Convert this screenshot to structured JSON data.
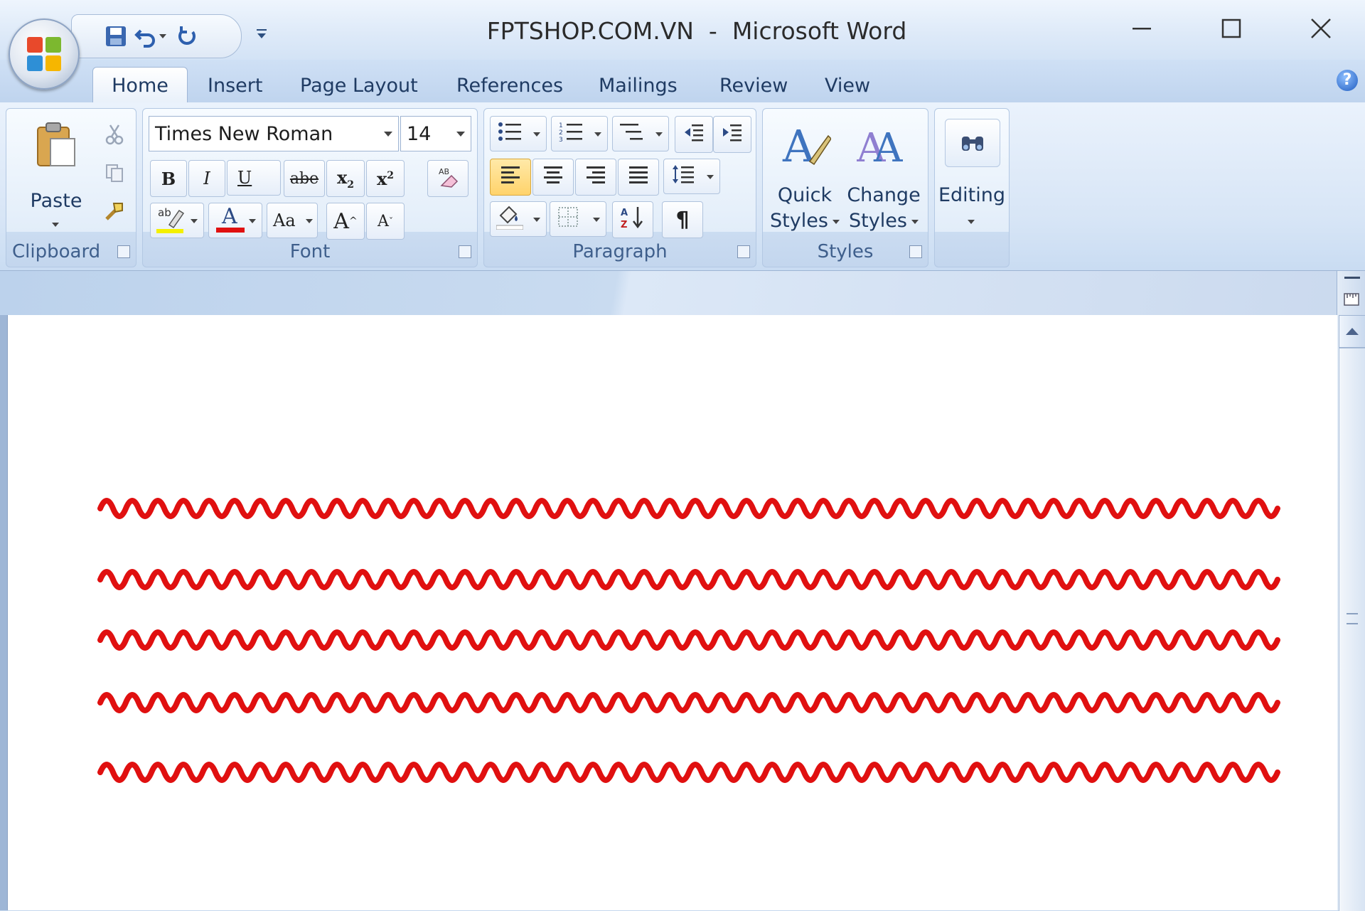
{
  "window": {
    "title": "FPTSHOP.COM.VN  -  Microsoft Word"
  },
  "quick_access": {
    "icons": [
      "save-icon",
      "undo-icon",
      "redo-icon",
      "customize-icon"
    ]
  },
  "tabs": [
    {
      "label": "Home",
      "active": true
    },
    {
      "label": "Insert"
    },
    {
      "label": "Page Layout"
    },
    {
      "label": "References"
    },
    {
      "label": "Mailings"
    },
    {
      "label": "Review"
    },
    {
      "label": "View"
    }
  ],
  "ribbon": {
    "clipboard": {
      "group_label": "Clipboard",
      "paste_label": "Paste"
    },
    "font": {
      "group_label": "Font",
      "font_name": "Times New Roman",
      "font_size": "14",
      "bold": "B",
      "italic": "I",
      "underline": "U",
      "strikethrough": "abe",
      "change_case": "Aa",
      "grow": "A",
      "shrink": "A",
      "highlight_color": "#f4f000",
      "font_color": "#e01010"
    },
    "paragraph": {
      "group_label": "Paragraph",
      "pilcrow": "¶"
    },
    "styles": {
      "group_label": "Styles",
      "quick_styles_line1": "Quick",
      "quick_styles_line2": "Styles",
      "change_styles_line1": "Change",
      "change_styles_line2": "Styles"
    },
    "editing": {
      "label": "Editing"
    }
  },
  "document": {
    "squiggle_color": "#e01010",
    "squiggle_line_count": 5
  }
}
